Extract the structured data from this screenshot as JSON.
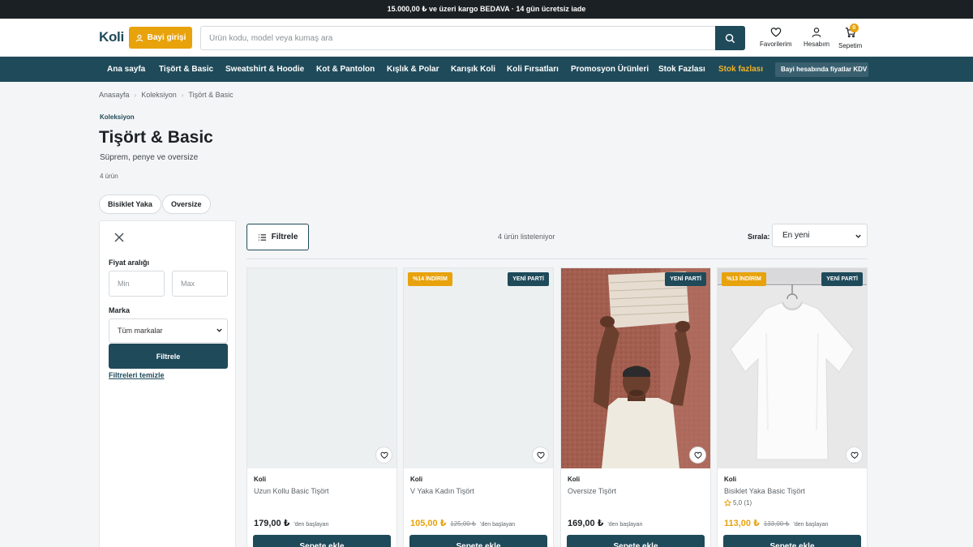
{
  "topbar": {
    "text": "15.000,00 ₺ ve üzeri kargo BEDAVA · 14 gün ücretsiz iade"
  },
  "header": {
    "logo": "Koli",
    "dealer_login": "Bayi girişi",
    "search_placeholder": "Ürün kodu, model veya kumaş ara",
    "favorites": "Favorilerim",
    "account": "Hesabım",
    "cart": "Sepetim",
    "cart_count": "0"
  },
  "nav": {
    "items": [
      "Ana sayfa",
      "Tişört & Basic",
      "Sweatshirt & Hoodie",
      "Kot & Pantolon",
      "Kışlık & Polar",
      "Karışık Koli",
      "Koli Fırsatları",
      "Promosyon Ürünleri",
      "Stok Fazlası",
      "Stok fazlası"
    ],
    "note": "Bayi hesabında fiyatlar KDV hariç"
  },
  "breadcrumb": [
    "Anasayfa",
    "Koleksiyon",
    "Tişört & Basic"
  ],
  "page": {
    "eyebrow": "Koleksiyon",
    "title": "Tişört & Basic",
    "subtitle": "Süprem, penye ve oversize",
    "count": "4 ürün",
    "chips": [
      "Bisiklet Yaka",
      "Oversize"
    ]
  },
  "filters": {
    "price_label": "Fiyat aralığı",
    "min_placeholder": "Min",
    "max_placeholder": "Max",
    "brand_label": "Marka",
    "brand_value": "Tüm markalar",
    "apply": "Filtrele",
    "clear": "Filtreleri temizle"
  },
  "toolbar": {
    "filter_button": "Filtrele",
    "listing": "4 ürün listeleniyor",
    "sort_label": "Sırala:",
    "sort_value": "En yeni"
  },
  "products": [
    {
      "brand": "Koli",
      "name": "Uzun Kollu Basic Tişört",
      "price": "179,00 ₺",
      "old_price": "",
      "from": "'den başlayan",
      "sale_badge": "",
      "new_badge": "",
      "rating": "",
      "cart": "Sepete ekle",
      "image": "placeholder"
    },
    {
      "brand": "Koli",
      "name": "V Yaka Kadın Tişört",
      "price": "105,00 ₺",
      "old_price": "125,00 ₺",
      "from": "'den başlayan",
      "sale_badge": "%14 İNDİRİM",
      "new_badge": "YENİ PARTİ",
      "rating": "",
      "cart": "Sepete ekle",
      "image": "placeholder"
    },
    {
      "brand": "Koli",
      "name": "Oversize Tişört",
      "price": "169,00 ₺",
      "old_price": "",
      "from": "'den başlayan",
      "sale_badge": "",
      "new_badge": "YENİ PARTİ",
      "rating": "",
      "cart": "Sepete ekle",
      "image": "model-photo"
    },
    {
      "brand": "Koli",
      "name": "Bisiklet Yaka Basic Tişört",
      "price": "113,00 ₺",
      "old_price": "133,00 ₺",
      "from": "'den başlayan",
      "sale_badge": "%13 İNDİRİM",
      "new_badge": "YENİ PARTİ",
      "rating": "5,0 (1)",
      "cart": "Sepete ekle",
      "image": "tshirt-photo"
    }
  ],
  "colors": {
    "primary": "#1f4a5a",
    "accent": "#e8a20c",
    "topbar": "#1b2024",
    "background": "#f4f5f6"
  },
  "icons": [
    "user-icon",
    "search-icon",
    "heart-icon",
    "account-icon",
    "cart-icon",
    "close-icon",
    "list-icon",
    "chevron-down-icon",
    "star-icon"
  ]
}
